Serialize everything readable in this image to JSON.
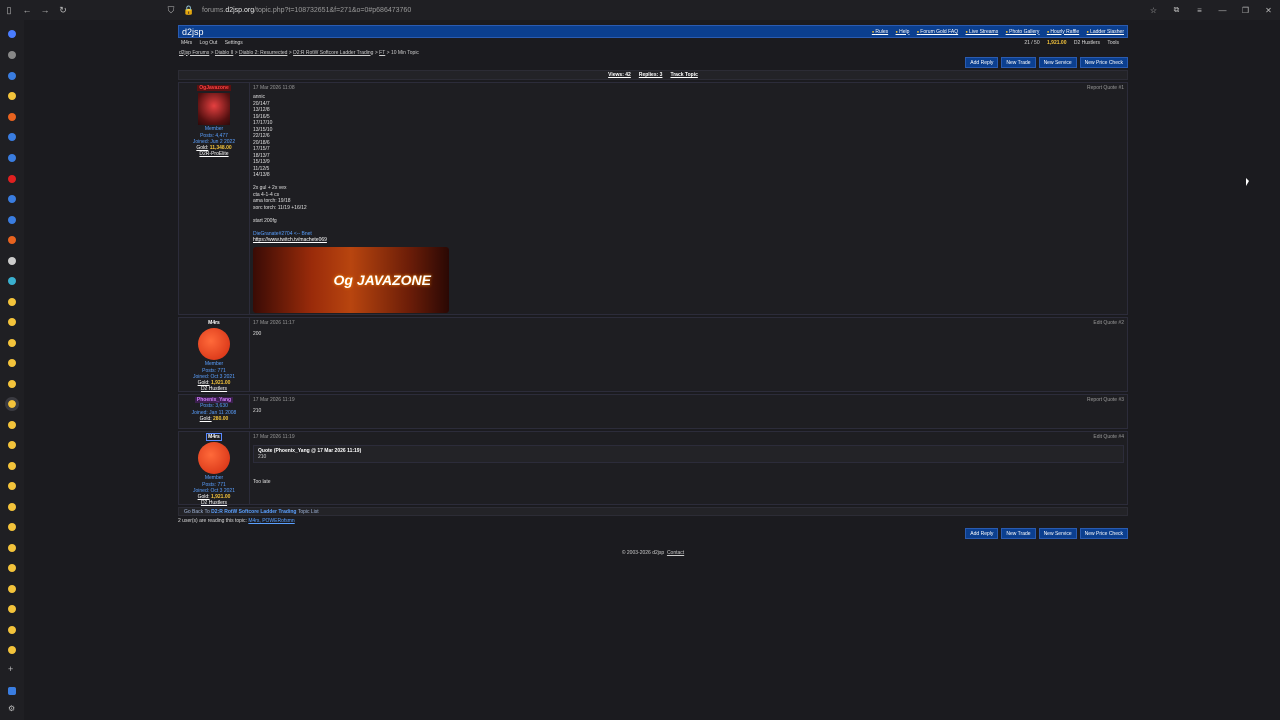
{
  "browser": {
    "url_host": "forums.",
    "url_domain": "d2jsp.org",
    "url_path": "/topic.php?t=108732651&f=271&o=0#p686473760"
  },
  "site": {
    "logo": "d2jsp",
    "top_links": [
      "Rules",
      "Help",
      "Forum Gold FAQ",
      "Live Streams",
      "Photo Gallery",
      "Hourly Raffle",
      "Ladder Slasher"
    ],
    "user_menu": [
      "M4rs",
      "Log Out",
      "Settings"
    ],
    "user_status": {
      "count": "21 / 50",
      "gold": "1,921.00",
      "group": "D2 Hustlers",
      "tools": "Tools"
    }
  },
  "breadcrumb": [
    "d2jsp Forums",
    "Diablo II",
    "Diablo 2: Resurrected",
    "D2:R RotW Softcore Ladder Trading",
    "FT",
    "10 Min Topic"
  ],
  "buttons": [
    "Add Reply",
    "New Trade",
    "New Service",
    "New Price Check"
  ],
  "stats": {
    "views": "Views: 42",
    "replies": "Replies: 3",
    "track": "Track Topic"
  },
  "posts": [
    {
      "user": "OgJavazone",
      "rank": "Member",
      "posts": "Posts: 4,477",
      "joined": "Joined: Jun 2 2022",
      "gold_label": "Gold:",
      "gold": "11,348.00",
      "group": "D2R-ProElite",
      "date": "17 Mar 2026 11:08",
      "actions": "Report   Quote   #1",
      "text": "annic\n20/14/7\n13/12/8\n19/16/5\n17/17/10\n13/15/10\n22/12/6\n20/18/6\n17/15/7\n18/13/7\n15/13/9\n11/12/5\n14/13/8\n\n2x gul + 2x vex\ncta 4-1-4 cs\nama torch: 19/18\nsorc torch: 11/19 +16/12\n\nstart 200fg",
      "sig1": "DieGranate#2704 <-- Bnet",
      "sig2": "https://www.twitch.tv/machete069",
      "banner": "Og JAVAZONE"
    },
    {
      "user": "M4rs",
      "rank": "Member",
      "posts": "Posts: 771",
      "joined": "Joined: Oct 3 2021",
      "gold_label": "Gold:",
      "gold": "1,921.00",
      "group": "D2 Hustlers",
      "date": "17 Mar 2026 11:17",
      "actions": "Edit   Quote   #2",
      "text": "200"
    },
    {
      "user": "Phoenix_Yang",
      "posts": "Posts: 3,630",
      "joined": "Joined: Jan 11 2008",
      "gold_label": "Gold:",
      "gold": "280.00",
      "date": "17 Mar 2026 11:19",
      "actions": "Report   Quote   #3",
      "text": "210"
    },
    {
      "user": "M4rs",
      "rank": "Member",
      "posts": "Posts: 771",
      "joined": "Joined: Oct 3 2021",
      "gold_label": "Gold:",
      "gold": "1,921.00",
      "group": "D2 Hustlers",
      "date": "17 Mar 2026 11:19",
      "actions": "Edit   Quote   #4",
      "quote_head": "Quote (Phoenix_Yang @ 17 Mar 2026 11:19)",
      "quote_text": "210",
      "text": "Too late"
    }
  ],
  "footer": {
    "go_back": "Go Back To",
    "forum": "D2:R RotW Softcore Ladder Trading",
    "topic_list": "Topic List",
    "readers_prefix": "2 user(s) are reading this topic:",
    "readers": "M4rs, POWERofsmn",
    "copyright": "© 2003-2026 d2jsp",
    "contact": "Contact"
  }
}
